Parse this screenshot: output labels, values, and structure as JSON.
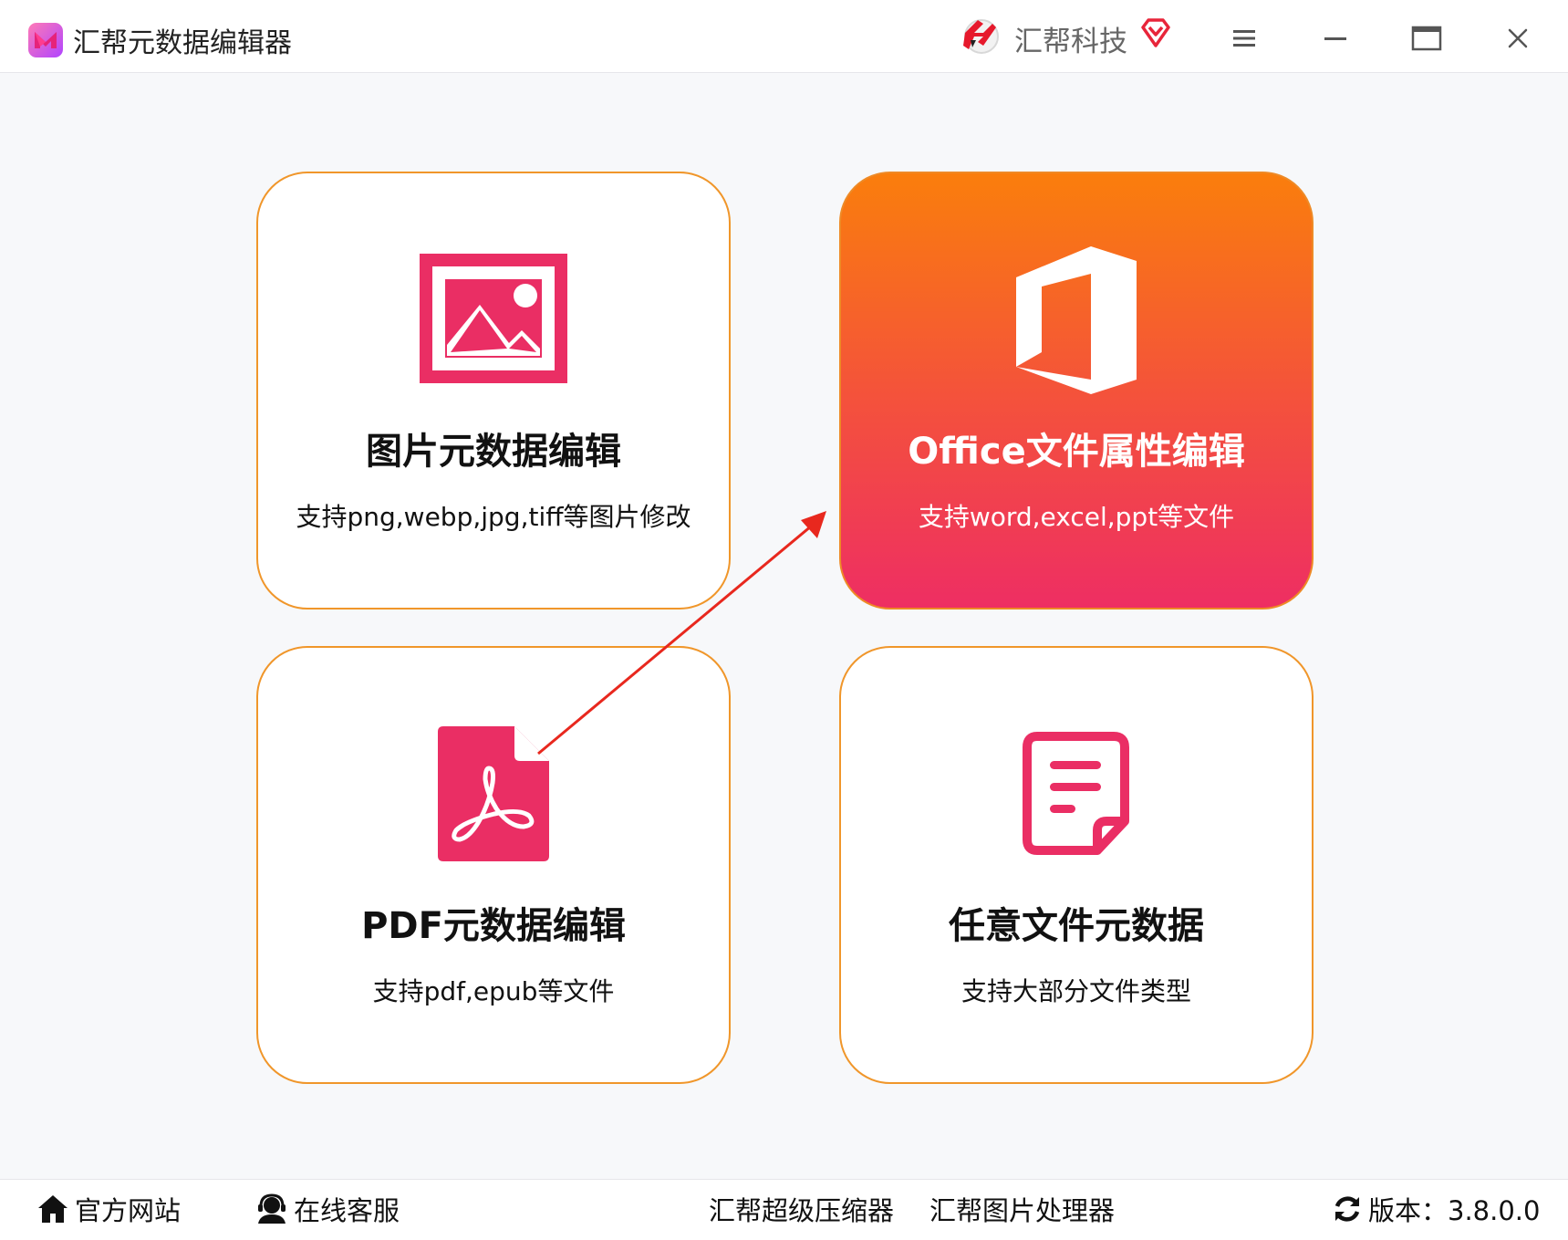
{
  "window": {
    "title": "汇帮元数据编辑器",
    "brand": "汇帮科技"
  },
  "cards": [
    {
      "id": "image",
      "title": "图片元数据编辑",
      "desc": "支持png,webp,jpg,tiff等图片修改",
      "active": false
    },
    {
      "id": "office",
      "title": "Office文件属性编辑",
      "desc": "支持word,excel,ppt等文件",
      "active": true
    },
    {
      "id": "pdf",
      "title": "PDF元数据编辑",
      "desc": "支持pdf,epub等文件",
      "active": false
    },
    {
      "id": "any",
      "title": "任意文件元数据",
      "desc": "支持大部分文件类型",
      "active": false
    }
  ],
  "footer": {
    "website": "官方网站",
    "support": "在线客服",
    "compressor": "汇帮超级压缩器",
    "image_processor": "汇帮图片处理器",
    "version": "版本：3.8.0.0"
  },
  "colors": {
    "accent_pink": "#ea2e64",
    "accent_orange": "#fa7e0c",
    "card_border": "#f0962a",
    "annotation_arrow": "#e8281e"
  },
  "icons": {
    "app": "app-logo-icon",
    "brand": "brand-logo-icon",
    "vip": "vip-diamond-icon",
    "menu": "menu-icon",
    "minimize": "minimize-icon",
    "maximize": "maximize-icon",
    "close": "close-icon",
    "image": "image-icon",
    "office": "office-icon",
    "pdf": "pdf-icon",
    "document": "document-icon",
    "home": "home-icon",
    "support": "support-icon",
    "refresh": "refresh-icon"
  }
}
